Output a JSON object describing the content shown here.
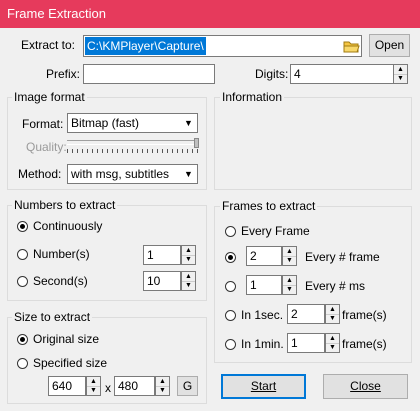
{
  "window": {
    "title": "Frame Extraction"
  },
  "extract": {
    "label": "Extract to:",
    "path": "C:\\KMPlayer\\Capture\\",
    "open_label": "Open"
  },
  "prefix": {
    "label": "Prefix:",
    "value": ""
  },
  "digits": {
    "label": "Digits:",
    "value": "4"
  },
  "image_format": {
    "title": "Image format",
    "format_label": "Format:",
    "format_value": "Bitmap (fast)",
    "quality_label": "Quality:",
    "method_label": "Method:",
    "method_value": "with msg, subtitles"
  },
  "information": {
    "title": "Information"
  },
  "numbers": {
    "title": "Numbers to extract",
    "continuously": "Continuously",
    "numbers_label": "Number(s)",
    "numbers_value": "1",
    "seconds_label": "Second(s)",
    "seconds_value": "10"
  },
  "size": {
    "title": "Size to extract",
    "original": "Original size",
    "specified": "Specified size",
    "width": "640",
    "x_label": "x",
    "height": "480",
    "g_label": "G"
  },
  "frames": {
    "title": "Frames to extract",
    "every_frame": "Every Frame",
    "every_n_value": "2",
    "every_n_label": "Every # frame",
    "every_ms_value": "1",
    "every_ms_label": "Every # ms",
    "in1sec_label": "In 1sec.",
    "in1sec_value": "2",
    "in1sec_unit": "frame(s)",
    "in1min_label": "In 1min.",
    "in1min_value": "1",
    "in1min_unit": "frame(s)"
  },
  "actions": {
    "start_label": "Start",
    "close_label": "Close"
  },
  "colors": {
    "titlebar": "#e63a5c",
    "selection": "#0078d7"
  }
}
